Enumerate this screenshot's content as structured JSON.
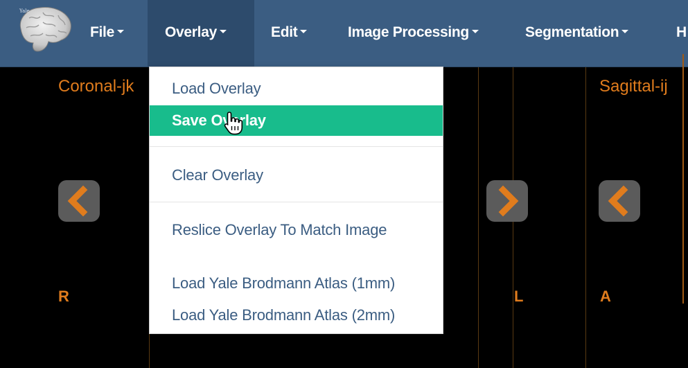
{
  "logo": {
    "text": "Yale"
  },
  "nav": {
    "items": [
      {
        "label": "File",
        "active": false
      },
      {
        "label": "Overlay",
        "active": true
      },
      {
        "label": "Edit",
        "active": false
      },
      {
        "label": "Image Processing",
        "active": false
      },
      {
        "label": "Segmentation",
        "active": false
      },
      {
        "label": "H",
        "active": false
      }
    ]
  },
  "viewer": {
    "coronal_label": "Coronal-jk",
    "sagittal_label": "Sagittal-ij",
    "orient": {
      "left": "R",
      "right": "L",
      "sagittal_left": "A"
    }
  },
  "overlay_menu": {
    "items": [
      {
        "label": "Load Overlay"
      },
      {
        "label": "Save Overlay"
      },
      {
        "label": "Clear Overlay"
      },
      {
        "label": "Reslice Overlay To Match Image"
      },
      {
        "label": "Load Yale Brodmann Atlas (1mm)"
      },
      {
        "label": "Load Yale Brodmann Atlas (2mm)"
      }
    ]
  },
  "colors": {
    "navbar": "#3b5d82",
    "navbar_active": "#2d4b6c",
    "menu_hover": "#18bc8c",
    "menu_text": "#3b5d82",
    "viewer_label": "#e07c1d",
    "arrow_bg": "#5b5b5b",
    "arrow_fg": "#e07c1d"
  },
  "icons": {
    "logo": "brain-icon",
    "prev": "chevron-left-icon",
    "next": "chevron-right-icon",
    "cursor": "hand-pointer-icon"
  }
}
